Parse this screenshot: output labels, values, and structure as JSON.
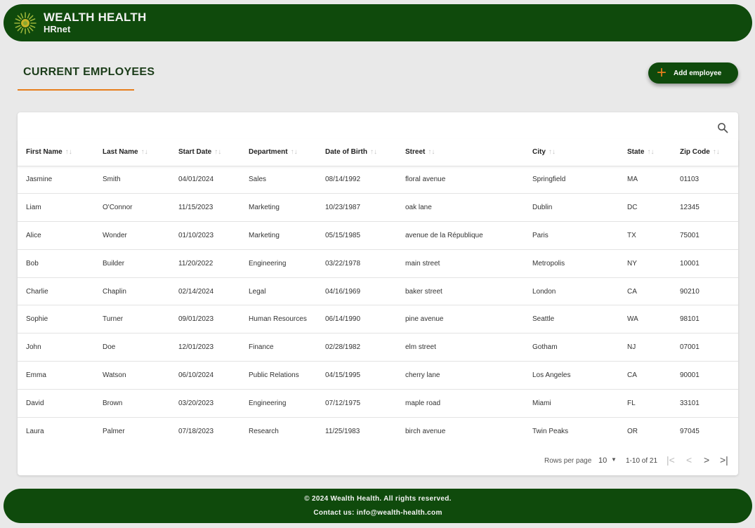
{
  "header": {
    "brand_title": "WEALTH HEALTH",
    "brand_subtitle": "HRnet",
    "logo_icon": "wealth-health-sunburst-logo",
    "bg_color": "#0f4a0c"
  },
  "page": {
    "title": "CURRENT EMPLOYEES",
    "accent_color": "#e77e1d",
    "add_button_label": "Add employee",
    "add_button_icon": "plus-icon"
  },
  "table": {
    "search_icon": "search-icon",
    "sort_icon": "↑↓",
    "columns": [
      "First Name",
      "Last Name",
      "Start Date",
      "Department",
      "Date of Birth",
      "Street",
      "City",
      "State",
      "Zip Code"
    ],
    "rows": [
      [
        "Jasmine",
        "Smith",
        "04/01/2024",
        "Sales",
        "08/14/1992",
        "floral avenue",
        "Springfield",
        "MA",
        "01103"
      ],
      [
        "Liam",
        "O'Connor",
        "11/15/2023",
        "Marketing",
        "10/23/1987",
        "oak lane",
        "Dublin",
        "DC",
        "12345"
      ],
      [
        "Alice",
        "Wonder",
        "01/10/2023",
        "Marketing",
        "05/15/1985",
        "avenue de la République",
        "Paris",
        "TX",
        "75001"
      ],
      [
        "Bob",
        "Builder",
        "11/20/2022",
        "Engineering",
        "03/22/1978",
        "main street",
        "Metropolis",
        "NY",
        "10001"
      ],
      [
        "Charlie",
        "Chaplin",
        "02/14/2024",
        "Legal",
        "04/16/1969",
        "baker street",
        "London",
        "CA",
        "90210"
      ],
      [
        "Sophie",
        "Turner",
        "09/01/2023",
        "Human Resources",
        "06/14/1990",
        "pine avenue",
        "Seattle",
        "WA",
        "98101"
      ],
      [
        "John",
        "Doe",
        "12/01/2023",
        "Finance",
        "02/28/1982",
        "elm street",
        "Gotham",
        "NJ",
        "07001"
      ],
      [
        "Emma",
        "Watson",
        "06/10/2024",
        "Public Relations",
        "04/15/1995",
        "cherry lane",
        "Los Angeles",
        "CA",
        "90001"
      ],
      [
        "David",
        "Brown",
        "03/20/2023",
        "Engineering",
        "07/12/1975",
        "maple road",
        "Miami",
        "FL",
        "33101"
      ],
      [
        "Laura",
        "Palmer",
        "07/18/2023",
        "Research",
        "11/25/1983",
        "birch avenue",
        "Twin Peaks",
        "OR",
        "97045"
      ]
    ]
  },
  "pagination": {
    "rows_per_page_label": "Rows per page",
    "rows_per_page_value": "10",
    "range_text": "1-10 of 21",
    "first_icon": "|<",
    "prev_icon": "<",
    "next_icon": ">",
    "last_icon": ">|"
  },
  "footer": {
    "copyright": "© 2024 Wealth Health. All rights reserved.",
    "contact": "Contact us: info@wealth-health.com"
  }
}
